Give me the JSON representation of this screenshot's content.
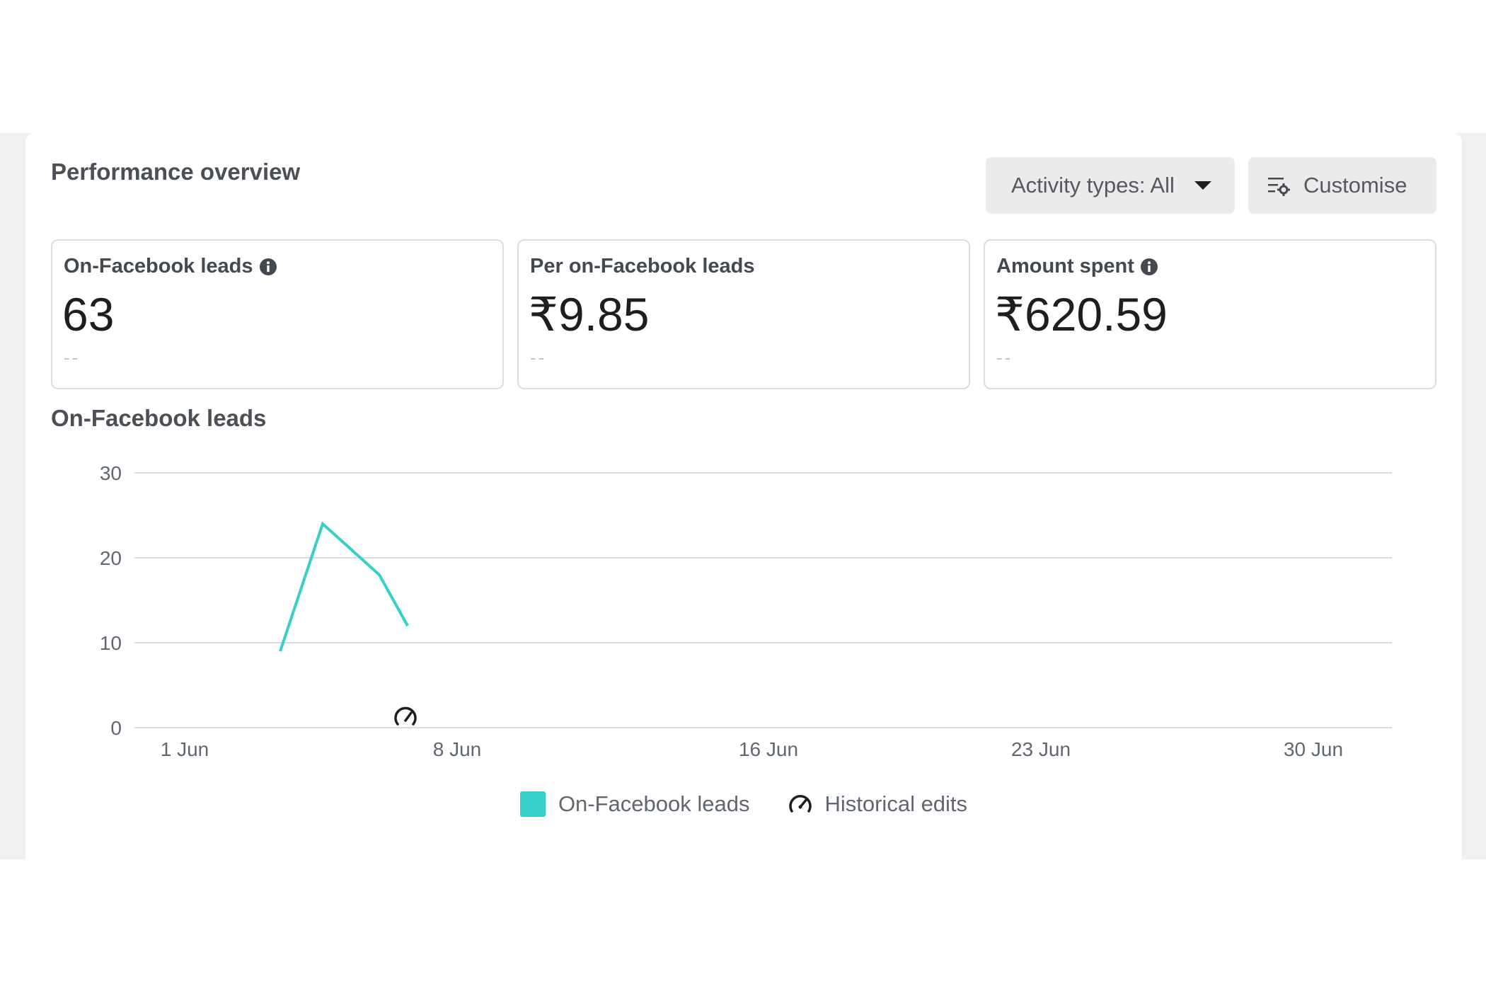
{
  "header": {
    "title": "Performance overview",
    "activity_button_label": "Activity types: All",
    "customise_button_label": "Customise"
  },
  "kpis": [
    {
      "label": "On-Facebook leads",
      "value": "63",
      "compare": "--",
      "has_info": true
    },
    {
      "label": "Per on-Facebook leads",
      "value": "₹9.85",
      "compare": "--",
      "has_info": false
    },
    {
      "label": "Amount spent",
      "value": "₹620.59",
      "compare": "--",
      "has_info": true
    }
  ],
  "colors": {
    "series": "#36cfc9",
    "grid": "#dadde1",
    "axis_text": "#606770"
  },
  "chart_data": {
    "type": "line",
    "title": "On-Facebook leads",
    "x_ticks": [
      "1 Jun",
      "8 Jun",
      "16 Jun",
      "23 Jun",
      "30 Jun"
    ],
    "y_ticks": [
      "0",
      "10",
      "20",
      "30"
    ],
    "ylim": [
      0,
      30
    ],
    "grid": true,
    "legend_position": "bottom-center",
    "series": [
      {
        "name": "On-Facebook leads",
        "x": [
          "3 Jun",
          "4 Jun",
          "5 Jun",
          "6 Jun"
        ],
        "values": [
          9,
          24,
          18,
          12
        ]
      }
    ],
    "markers": [
      {
        "name": "Historical edits",
        "x": "6 Jun"
      }
    ]
  },
  "legend": {
    "series_label": "On-Facebook leads",
    "edits_label": "Historical edits"
  }
}
